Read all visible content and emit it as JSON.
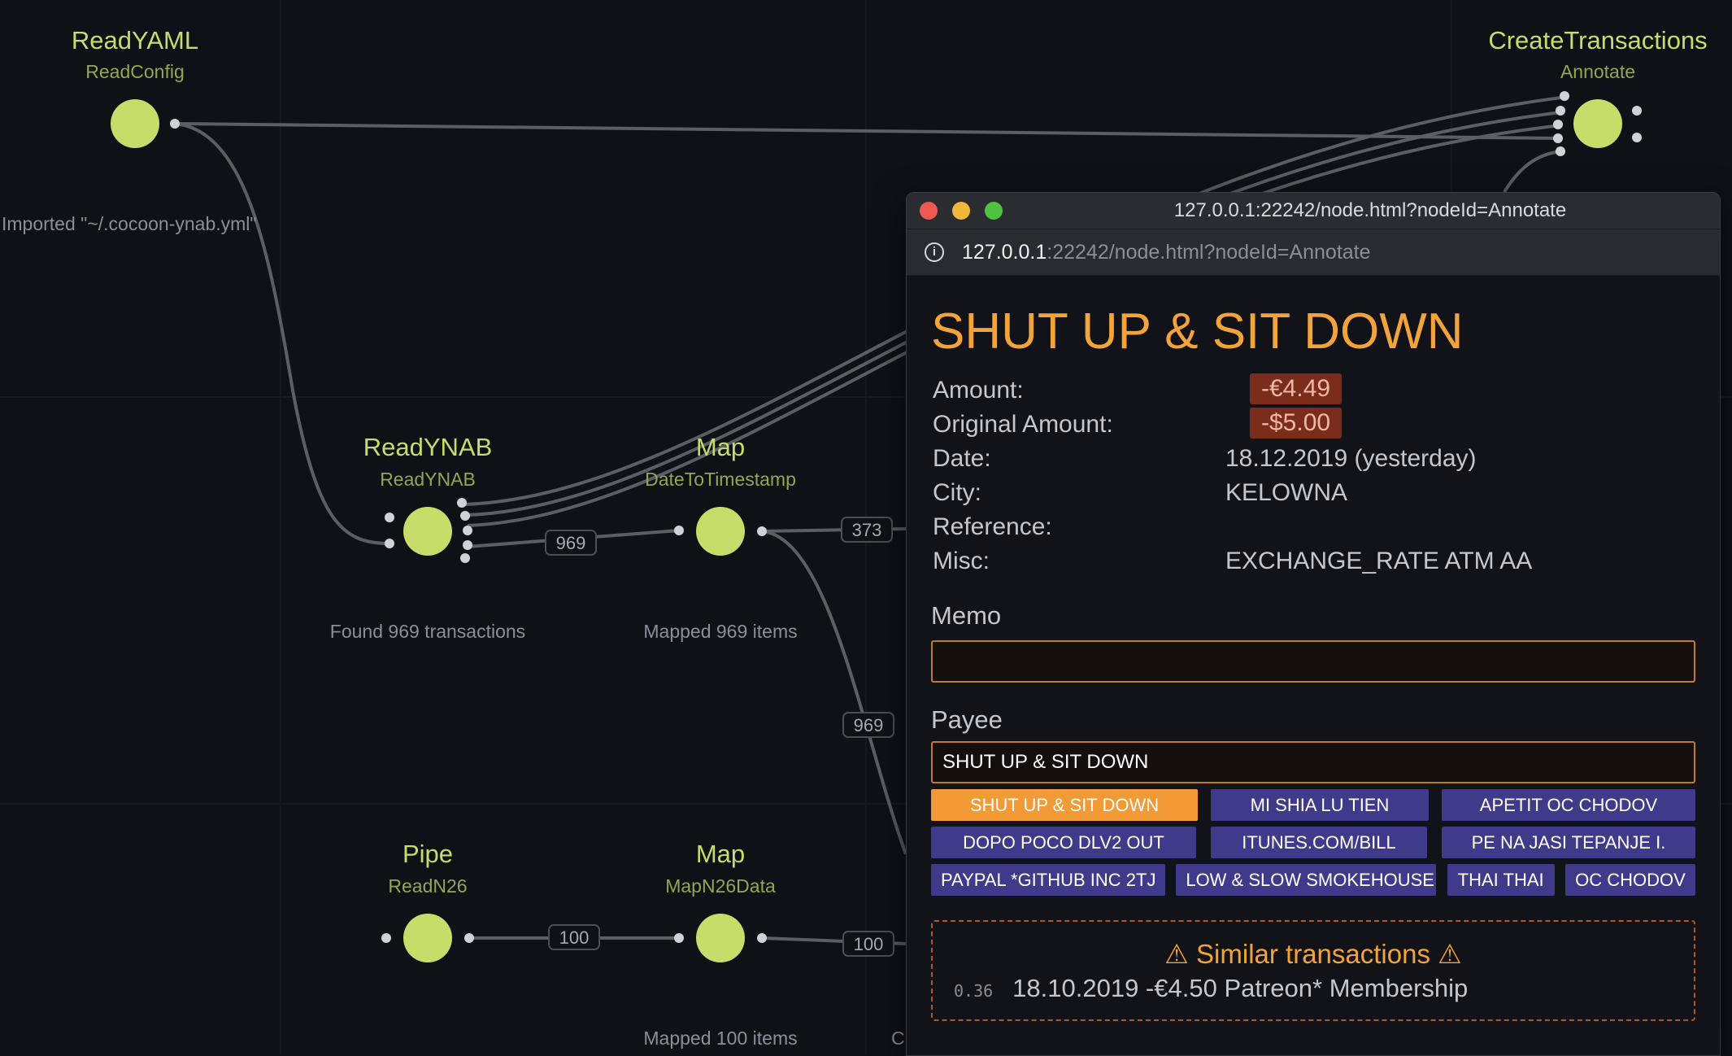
{
  "graph": {
    "nodes": {
      "read_yaml": {
        "title": "ReadYAML",
        "type": "ReadConfig",
        "status": "Imported \"~/.cocoon-ynab.yml\""
      },
      "create_transactions": {
        "title": "CreateTransactions",
        "type": "Annotate"
      },
      "read_ynab": {
        "title": "ReadYNAB",
        "type": "ReadYNAB",
        "status": "Found 969 transactions"
      },
      "map_date": {
        "title": "Map",
        "type": "DateToTimestamp",
        "status": "Mapped 969 items"
      },
      "pipe": {
        "title": "Pipe",
        "type": "ReadN26"
      },
      "map_n26": {
        "title": "Map",
        "type": "MapN26Data",
        "status": "Mapped 100 items",
        "status_extra": "C"
      }
    },
    "edge_counts": {
      "ynab_to_map": "969",
      "map_out_373": "373",
      "map_down_969": "969",
      "pipe_to_map": "100",
      "map_out_100": "100"
    }
  },
  "browser": {
    "window_title": "127.0.0.1:22242/node.html?nodeId=Annotate",
    "url_host": "127.0.0.1",
    "url_rest": ":22242/node.html?nodeId=Annotate",
    "info_icon": "i"
  },
  "transaction": {
    "payee_heading": "SHUT UP & SIT DOWN",
    "labels": {
      "amount": "Amount:",
      "original_amount": "Original Amount:",
      "date": "Date:",
      "city": "City:",
      "reference": "Reference:",
      "misc": "Misc:"
    },
    "amount": "-€4.49",
    "original_amount": "-$5.00",
    "date": "18.12.2019 (yesterday)",
    "city": "KELOWNA",
    "reference": "",
    "misc": "EXCHANGE_RATE ATM AA"
  },
  "form": {
    "memo_label": "Memo",
    "memo_value": "",
    "payee_label": "Payee",
    "payee_value": "SHUT UP & SIT DOWN",
    "suggestions": [
      [
        "SHUT UP & SIT DOWN",
        "MI SHIA LU TIEN",
        "APETIT OC CHODOV"
      ],
      [
        "DOPO POCO DLV2 OUT",
        "ITUNES.COM/BILL",
        "PE NA JASI TEPANJE I."
      ],
      [
        "PAYPAL *GITHUB INC 2TJ",
        "LOW & SLOW SMOKEHOUSE",
        "THAI THAI",
        "OC CHODOV"
      ]
    ]
  },
  "similar": {
    "title": "⚠ Similar transactions ⚠",
    "score": "0.36",
    "text": "18.10.2019 -€4.50 Patreon* Membership"
  },
  "colors": {
    "node": "#c8dc6a",
    "accent": "#f2a33a",
    "chip": "#3f3a8a",
    "chip_selected": "#f19a36",
    "amount_badge": "#7b2d1b"
  }
}
